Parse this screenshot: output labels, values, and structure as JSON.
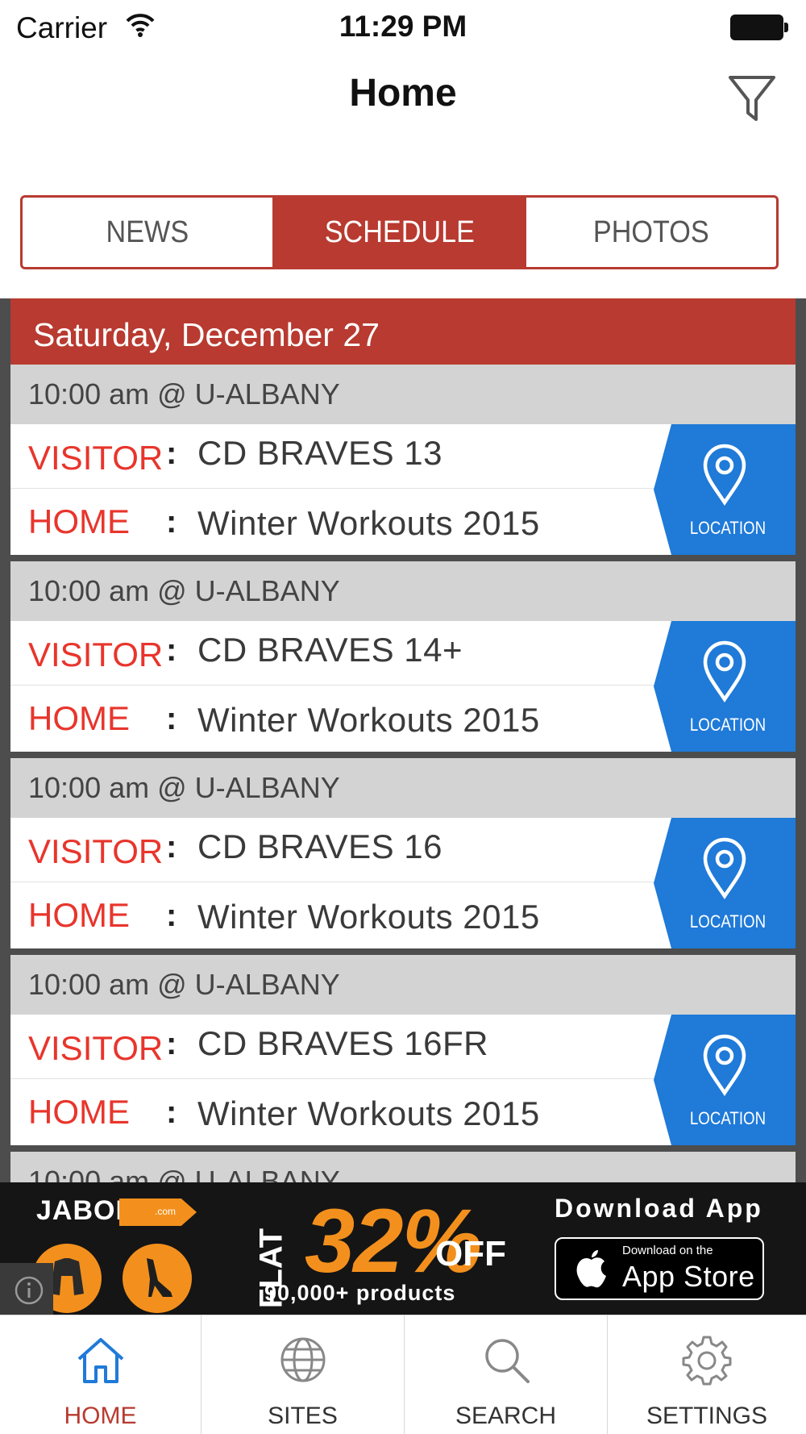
{
  "status_bar": {
    "carrier": "Carrier",
    "time": "11:29 PM"
  },
  "nav": {
    "title": "Home",
    "filter_icon": "filter-icon"
  },
  "segments": [
    {
      "label": "NEWS",
      "active": false
    },
    {
      "label": "SCHEDULE",
      "active": true
    },
    {
      "label": "PHOTOS",
      "active": false
    }
  ],
  "schedule": {
    "date": "Saturday, December 27",
    "visitor_label": "VISITOR",
    "home_label": "HOME",
    "separator": ":",
    "location_label": "LOCATION",
    "games": [
      {
        "time": "10:00 am @  U-ALBANY",
        "visitor": "CD BRAVES 13",
        "home": "Winter Workouts 2015"
      },
      {
        "time": "10:00 am @  U-ALBANY",
        "visitor": "CD BRAVES 14+",
        "home": "Winter Workouts 2015"
      },
      {
        "time": "10:00 am @  U-ALBANY",
        "visitor": "CD BRAVES 16",
        "home": "Winter Workouts 2015"
      },
      {
        "time": "10:00 am @  U-ALBANY",
        "visitor": "CD BRAVES 16FR",
        "home": "Winter Workouts 2015"
      }
    ],
    "partial_time": "10:00 am @  U-ALBANY"
  },
  "ad": {
    "brand": "JABONG",
    "brand_suffix": ".com",
    "flat": "FLAT",
    "percent": "32%",
    "off": "OFF",
    "products": "90,000+ products",
    "cta": "Download App",
    "store_small": "Download on the",
    "store_big": "App Store"
  },
  "tabs": [
    {
      "label": "HOME",
      "icon": "home-icon",
      "active": true
    },
    {
      "label": "SITES",
      "icon": "globe-icon",
      "active": false
    },
    {
      "label": "SEARCH",
      "icon": "search-icon",
      "active": false
    },
    {
      "label": "SETTINGS",
      "icon": "gear-icon",
      "active": false
    }
  ],
  "colors": {
    "accent_red": "#b83a30",
    "label_red": "#e8352c",
    "location_blue": "#1f7ad8",
    "ad_orange": "#f3901d"
  }
}
